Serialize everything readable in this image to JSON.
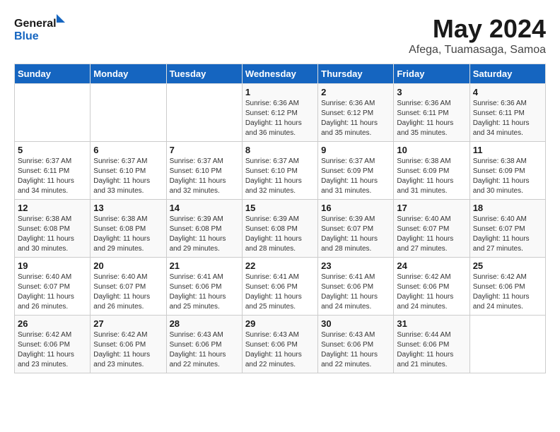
{
  "header": {
    "logo": {
      "line1": "General",
      "line2": "Blue"
    },
    "title": "May 2024",
    "subtitle": "Afega, Tuamasaga, Samoa"
  },
  "calendar": {
    "weekdays": [
      "Sunday",
      "Monday",
      "Tuesday",
      "Wednesday",
      "Thursday",
      "Friday",
      "Saturday"
    ],
    "weeks": [
      [
        {
          "day": "",
          "info": ""
        },
        {
          "day": "",
          "info": ""
        },
        {
          "day": "",
          "info": ""
        },
        {
          "day": "1",
          "info": "Sunrise: 6:36 AM\nSunset: 6:12 PM\nDaylight: 11 hours and 36 minutes."
        },
        {
          "day": "2",
          "info": "Sunrise: 6:36 AM\nSunset: 6:12 PM\nDaylight: 11 hours and 35 minutes."
        },
        {
          "day": "3",
          "info": "Sunrise: 6:36 AM\nSunset: 6:11 PM\nDaylight: 11 hours and 35 minutes."
        },
        {
          "day": "4",
          "info": "Sunrise: 6:36 AM\nSunset: 6:11 PM\nDaylight: 11 hours and 34 minutes."
        }
      ],
      [
        {
          "day": "5",
          "info": "Sunrise: 6:37 AM\nSunset: 6:11 PM\nDaylight: 11 hours and 34 minutes."
        },
        {
          "day": "6",
          "info": "Sunrise: 6:37 AM\nSunset: 6:10 PM\nDaylight: 11 hours and 33 minutes."
        },
        {
          "day": "7",
          "info": "Sunrise: 6:37 AM\nSunset: 6:10 PM\nDaylight: 11 hours and 32 minutes."
        },
        {
          "day": "8",
          "info": "Sunrise: 6:37 AM\nSunset: 6:10 PM\nDaylight: 11 hours and 32 minutes."
        },
        {
          "day": "9",
          "info": "Sunrise: 6:37 AM\nSunset: 6:09 PM\nDaylight: 11 hours and 31 minutes."
        },
        {
          "day": "10",
          "info": "Sunrise: 6:38 AM\nSunset: 6:09 PM\nDaylight: 11 hours and 31 minutes."
        },
        {
          "day": "11",
          "info": "Sunrise: 6:38 AM\nSunset: 6:09 PM\nDaylight: 11 hours and 30 minutes."
        }
      ],
      [
        {
          "day": "12",
          "info": "Sunrise: 6:38 AM\nSunset: 6:08 PM\nDaylight: 11 hours and 30 minutes."
        },
        {
          "day": "13",
          "info": "Sunrise: 6:38 AM\nSunset: 6:08 PM\nDaylight: 11 hours and 29 minutes."
        },
        {
          "day": "14",
          "info": "Sunrise: 6:39 AM\nSunset: 6:08 PM\nDaylight: 11 hours and 29 minutes."
        },
        {
          "day": "15",
          "info": "Sunrise: 6:39 AM\nSunset: 6:08 PM\nDaylight: 11 hours and 28 minutes."
        },
        {
          "day": "16",
          "info": "Sunrise: 6:39 AM\nSunset: 6:07 PM\nDaylight: 11 hours and 28 minutes."
        },
        {
          "day": "17",
          "info": "Sunrise: 6:40 AM\nSunset: 6:07 PM\nDaylight: 11 hours and 27 minutes."
        },
        {
          "day": "18",
          "info": "Sunrise: 6:40 AM\nSunset: 6:07 PM\nDaylight: 11 hours and 27 minutes."
        }
      ],
      [
        {
          "day": "19",
          "info": "Sunrise: 6:40 AM\nSunset: 6:07 PM\nDaylight: 11 hours and 26 minutes."
        },
        {
          "day": "20",
          "info": "Sunrise: 6:40 AM\nSunset: 6:07 PM\nDaylight: 11 hours and 26 minutes."
        },
        {
          "day": "21",
          "info": "Sunrise: 6:41 AM\nSunset: 6:06 PM\nDaylight: 11 hours and 25 minutes."
        },
        {
          "day": "22",
          "info": "Sunrise: 6:41 AM\nSunset: 6:06 PM\nDaylight: 11 hours and 25 minutes."
        },
        {
          "day": "23",
          "info": "Sunrise: 6:41 AM\nSunset: 6:06 PM\nDaylight: 11 hours and 24 minutes."
        },
        {
          "day": "24",
          "info": "Sunrise: 6:42 AM\nSunset: 6:06 PM\nDaylight: 11 hours and 24 minutes."
        },
        {
          "day": "25",
          "info": "Sunrise: 6:42 AM\nSunset: 6:06 PM\nDaylight: 11 hours and 24 minutes."
        }
      ],
      [
        {
          "day": "26",
          "info": "Sunrise: 6:42 AM\nSunset: 6:06 PM\nDaylight: 11 hours and 23 minutes."
        },
        {
          "day": "27",
          "info": "Sunrise: 6:42 AM\nSunset: 6:06 PM\nDaylight: 11 hours and 23 minutes."
        },
        {
          "day": "28",
          "info": "Sunrise: 6:43 AM\nSunset: 6:06 PM\nDaylight: 11 hours and 22 minutes."
        },
        {
          "day": "29",
          "info": "Sunrise: 6:43 AM\nSunset: 6:06 PM\nDaylight: 11 hours and 22 minutes."
        },
        {
          "day": "30",
          "info": "Sunrise: 6:43 AM\nSunset: 6:06 PM\nDaylight: 11 hours and 22 minutes."
        },
        {
          "day": "31",
          "info": "Sunrise: 6:44 AM\nSunset: 6:06 PM\nDaylight: 11 hours and 21 minutes."
        },
        {
          "day": "",
          "info": ""
        }
      ]
    ]
  }
}
